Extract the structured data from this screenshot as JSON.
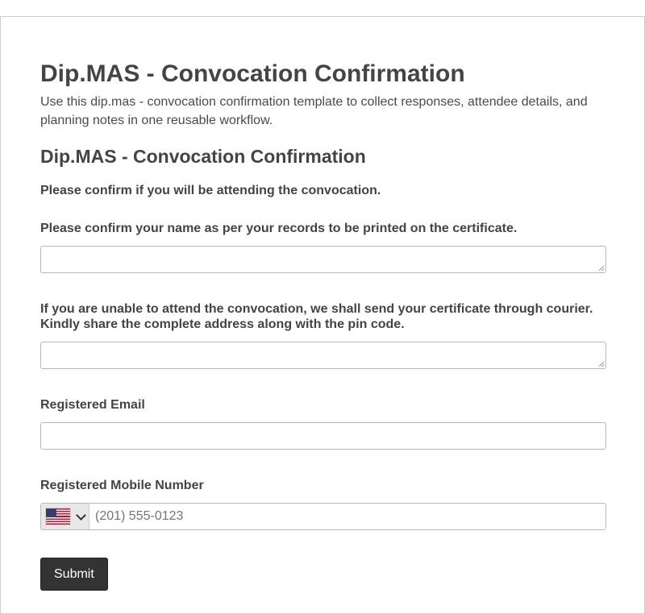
{
  "page": {
    "title": "Dip.MAS - Convocation Confirmation",
    "description": "Use this dip.mas - convocation confirmation template to collect responses, attendee details, and planning notes in one reusable workflow."
  },
  "form": {
    "title": "Dip.MAS - Convocation Confirmation",
    "questions": [
      {
        "label": "Please confirm if you will be attending the convocation."
      },
      {
        "label": "Please confirm your name as per your records to be printed on the certificate.",
        "value": ""
      },
      {
        "label": "If you are unable to attend the convocation, we shall send your certificate through courier. Kindly share the complete address along with the pin code.",
        "value": ""
      },
      {
        "label": "Registered Email",
        "value": ""
      },
      {
        "label": "Registered Mobile Number",
        "value": "",
        "placeholder": "(201) 555-0123",
        "country_icon": "us-flag-icon"
      }
    ],
    "submit_label": "Submit"
  },
  "colors": {
    "text": "#444444",
    "button_bg": "#333333",
    "button_text": "#ffffff",
    "border": "#b9b9b9",
    "country_bg": "#e8e8e8"
  }
}
